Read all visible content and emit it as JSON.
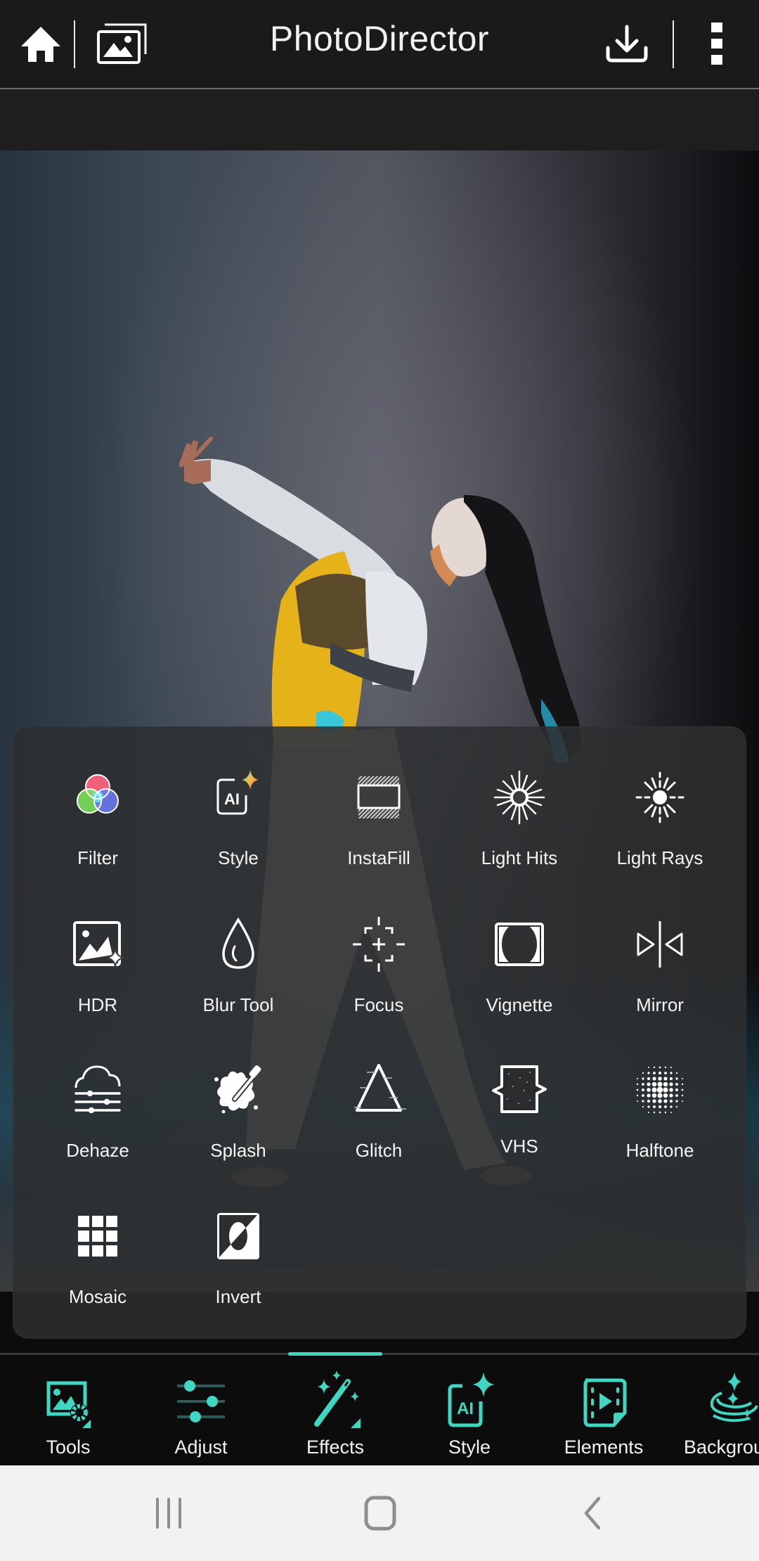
{
  "header": {
    "title": "PhotoDirector",
    "icons": {
      "home": "home-icon",
      "gallery": "gallery-icon",
      "save": "download-icon",
      "more": "more-vertical-icon"
    }
  },
  "effects_panel": {
    "items": [
      {
        "label": "Filter",
        "icon": "filter-icon"
      },
      {
        "label": "Style",
        "icon": "ai-style-icon"
      },
      {
        "label": "InstaFill",
        "icon": "instafill-icon"
      },
      {
        "label": "Light Hits",
        "icon": "light-hits-icon"
      },
      {
        "label": "Light Rays",
        "icon": "light-rays-icon"
      },
      {
        "label": "HDR",
        "icon": "hdr-icon"
      },
      {
        "label": "Blur Tool",
        "icon": "blur-drop-icon"
      },
      {
        "label": "Focus",
        "icon": "focus-icon"
      },
      {
        "label": "Vignette",
        "icon": "vignette-icon"
      },
      {
        "label": "Mirror",
        "icon": "mirror-icon"
      },
      {
        "label": "Dehaze",
        "icon": "dehaze-icon"
      },
      {
        "label": "Splash",
        "icon": "splash-icon"
      },
      {
        "label": "Glitch",
        "icon": "glitch-icon"
      },
      {
        "label": "VHS",
        "icon": "vhs-icon"
      },
      {
        "label": "Halftone",
        "icon": "halftone-icon"
      },
      {
        "label": "Mosaic",
        "icon": "mosaic-icon"
      },
      {
        "label": "Invert",
        "icon": "invert-icon"
      }
    ]
  },
  "toolbar": {
    "active": "Effects",
    "accent_color": "#3fd6c2",
    "items": [
      {
        "label": "Tools",
        "icon": "tools-icon"
      },
      {
        "label": "Adjust",
        "icon": "adjust-sliders-icon"
      },
      {
        "label": "Effects",
        "icon": "magic-wand-icon"
      },
      {
        "label": "Style",
        "icon": "ai-style-icon"
      },
      {
        "label": "Elements",
        "icon": "elements-icon"
      },
      {
        "label": "Background",
        "icon": "background-icon"
      }
    ]
  },
  "system_nav": {
    "recents": "recents-icon",
    "home": "home-circle-icon",
    "back": "back-icon"
  }
}
